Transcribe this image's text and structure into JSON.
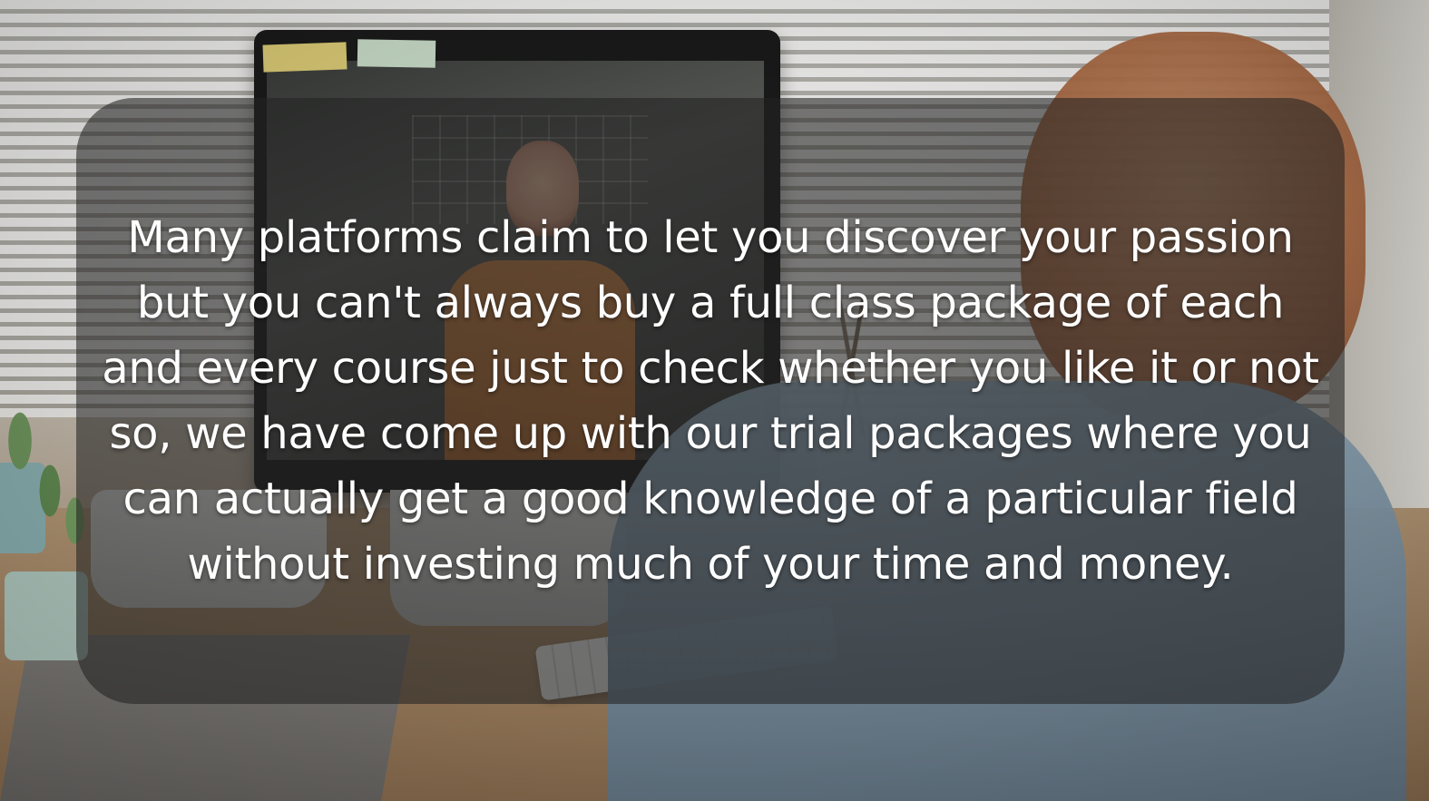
{
  "caption": {
    "text": "Many platforms claim to let you discover your passion but you can't always buy a full class package of each and every course just to check whether you like it or not so, we have come up with our trial packages where you can actually get a good knowledge of a particular field without investing much of your time and money."
  }
}
